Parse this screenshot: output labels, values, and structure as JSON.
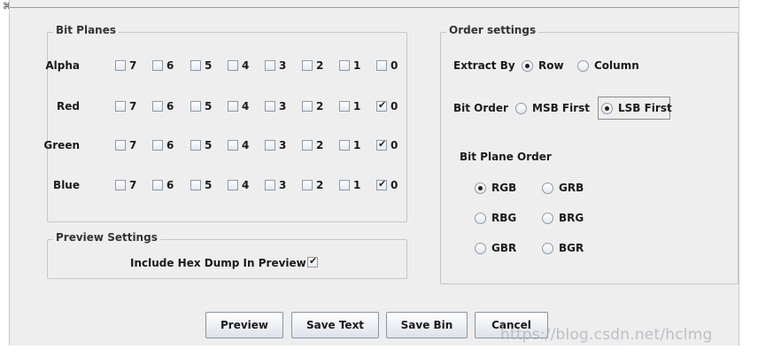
{
  "bit_planes": {
    "title": "Bit Planes",
    "bit_labels": [
      "7",
      "6",
      "5",
      "4",
      "3",
      "2",
      "1",
      "0"
    ],
    "rows": [
      {
        "label": "Alpha",
        "checked": [
          false,
          false,
          false,
          false,
          false,
          false,
          false,
          false
        ]
      },
      {
        "label": "Red",
        "checked": [
          false,
          false,
          false,
          false,
          false,
          false,
          false,
          true
        ]
      },
      {
        "label": "Green",
        "checked": [
          false,
          false,
          false,
          false,
          false,
          false,
          false,
          true
        ]
      },
      {
        "label": "Blue",
        "checked": [
          false,
          false,
          false,
          false,
          false,
          false,
          false,
          true
        ]
      }
    ]
  },
  "preview_settings": {
    "title": "Preview Settings",
    "hex_dump_label": "Include Hex Dump In Preview",
    "hex_dump_checked": true
  },
  "order_settings": {
    "title": "Order settings",
    "extract_by": {
      "label": "Extract By",
      "options": [
        "Row",
        "Column"
      ],
      "selected": "Row"
    },
    "bit_order": {
      "label": "Bit Order",
      "options": [
        "MSB First",
        "LSB First"
      ],
      "selected": "LSB First"
    },
    "bit_plane_order": {
      "label": "Bit Plane Order",
      "options": [
        "RGB",
        "GRB",
        "RBG",
        "BRG",
        "GBR",
        "BGR"
      ],
      "selected": "RGB"
    }
  },
  "buttons": {
    "preview": "Preview",
    "save_text": "Save Text",
    "save_bin": "Save Bin",
    "cancel": "Cancel"
  },
  "watermark": "https://blog.csdn.net/hclmg",
  "check_glyph": "✔"
}
